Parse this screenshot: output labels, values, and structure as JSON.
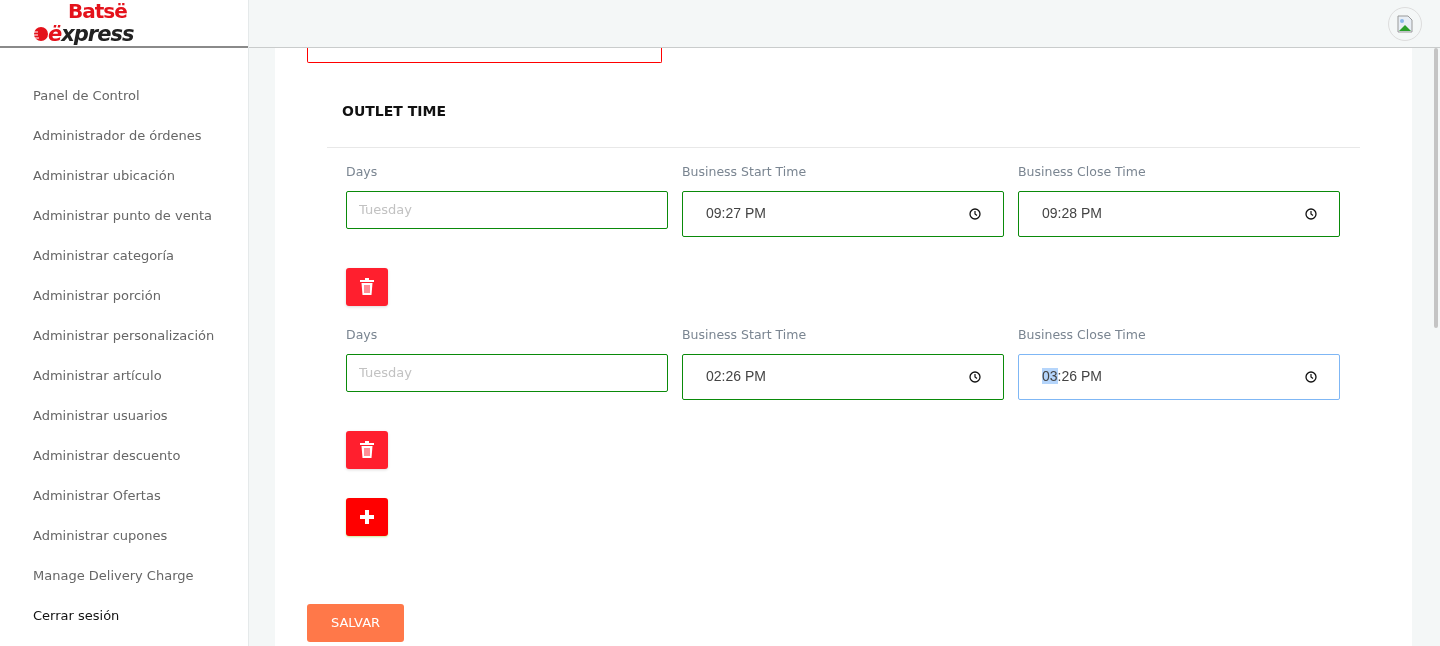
{
  "logo": {
    "top": "Batsë",
    "bottom": "ëxpress"
  },
  "sidebar": {
    "items": [
      {
        "label": "Panel de Control",
        "kind": "link"
      },
      {
        "label": "Administrador de órdenes",
        "kind": "link"
      },
      {
        "label": "Administrar ubicación",
        "kind": "link"
      },
      {
        "label": "Administrar punto de venta",
        "kind": "link"
      },
      {
        "label": "Administrar categoría",
        "kind": "link"
      },
      {
        "label": "Administrar porción",
        "kind": "link"
      },
      {
        "label": "Administrar personalización",
        "kind": "link"
      },
      {
        "label": "Administrar artículo",
        "kind": "link"
      },
      {
        "label": "Administrar usuarios",
        "kind": "link"
      },
      {
        "label": "Administrar descuento",
        "kind": "link"
      },
      {
        "label": "Administrar Ofertas",
        "kind": "link"
      },
      {
        "label": "Administrar cupones",
        "kind": "link"
      },
      {
        "label": "Manage Delivery Charge",
        "kind": "link"
      },
      {
        "label": "Cerrar sesión",
        "kind": "logout"
      }
    ]
  },
  "section": {
    "title": "OUTLET TIME"
  },
  "schedules": [
    {
      "days": {
        "label": "Days",
        "placeholder": "Tuesday"
      },
      "start": {
        "label": "Business Start Time",
        "value": "09:27 PM",
        "focused": false
      },
      "close": {
        "label": "Business Close Time",
        "value": "09:28 PM",
        "focused": false
      }
    },
    {
      "days": {
        "label": "Days",
        "placeholder": "Tuesday"
      },
      "start": {
        "label": "Business Start Time",
        "value": "02:26 PM",
        "focused": false
      },
      "close": {
        "label": "Business Close Time",
        "value": "03:26 PM",
        "focused": true
      }
    }
  ],
  "save_button": "SALVAR"
}
